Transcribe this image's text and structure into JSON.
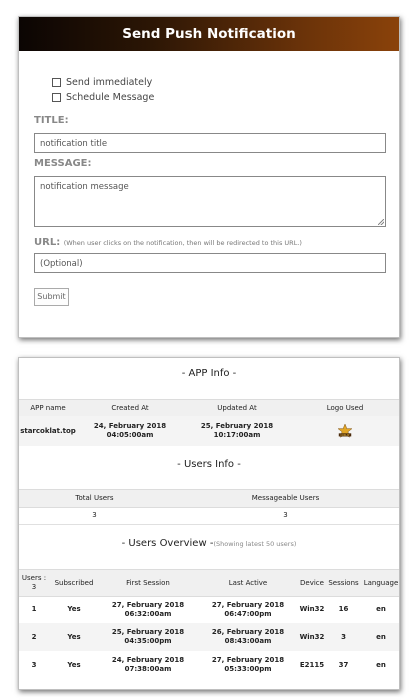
{
  "push_form": {
    "title": "Send Push Notification",
    "options": [
      {
        "label": "Send immediately",
        "checked": false
      },
      {
        "label": "Schedule Message",
        "checked": false
      }
    ],
    "title_label": "TITLE:",
    "title_placeholder": "notification title",
    "message_label": "MESSAGE:",
    "message_placeholder": "notification message",
    "url_label": "URL:",
    "url_hint": "(When user clicks on the notification, then will be redirected to this URL.)",
    "url_placeholder": "(Optional)",
    "submit_label": "Submit"
  },
  "app_info": {
    "section_title": "- APP Info -",
    "headers": [
      "APP name",
      "Created At",
      "Updated At",
      "Logo Used"
    ],
    "row": {
      "app_name": "starcoklat.top",
      "created_at": [
        "24, February 2018",
        "04:05:00am"
      ],
      "updated_at": [
        "25, February 2018",
        "10:17:00am"
      ],
      "logo_text": "COKLAT"
    }
  },
  "users_info": {
    "section_title": "- Users Info -",
    "headers": [
      "Total Users",
      "Messageable Users"
    ],
    "values": [
      "3",
      "3"
    ]
  },
  "users_overview": {
    "section_title": "- Users Overview -",
    "section_note": "(Showing latest 50 users)",
    "headers": [
      [
        "Users :",
        "3"
      ],
      [
        "Subscribed"
      ],
      [
        "First Session"
      ],
      [
        "Last Active"
      ],
      [
        "Device"
      ],
      [
        "Sessions"
      ],
      [
        "Language"
      ]
    ],
    "rows": [
      {
        "num": "1",
        "subscribed": "Yes",
        "first": [
          "27, February 2018",
          "06:32:00am"
        ],
        "last": [
          "27, February 2018",
          "06:47:00pm"
        ],
        "device": "Win32",
        "sessions": "16",
        "language": "en"
      },
      {
        "num": "2",
        "subscribed": "Yes",
        "first": [
          "25, February 2018",
          "04:35:00pm"
        ],
        "last": [
          "26, February 2018",
          "08:43:00am"
        ],
        "device": "Win32",
        "sessions": "3",
        "language": "en"
      },
      {
        "num": "3",
        "subscribed": "Yes",
        "first": [
          "24, February 2018",
          "07:38:00am"
        ],
        "last": [
          "27, February 2018",
          "05:33:00pm"
        ],
        "device": "E2115",
        "sessions": "37",
        "language": "en"
      }
    ]
  },
  "colors": {
    "header_dark": "#0b0503",
    "header_brown": "#8a420a",
    "logo_gold": "#e0a526"
  }
}
